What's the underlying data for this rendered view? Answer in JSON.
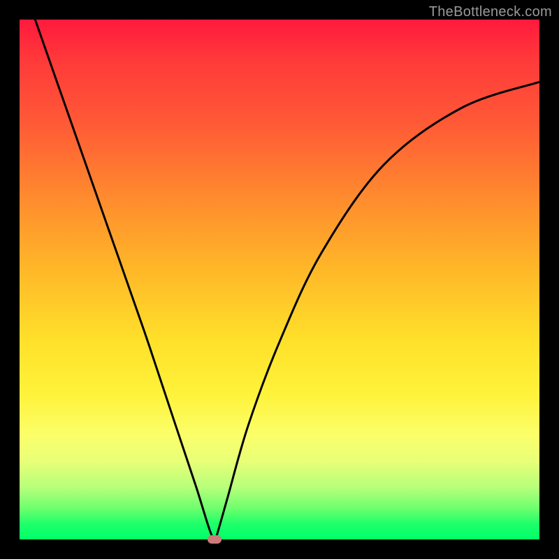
{
  "watermark": "TheBottleneck.com",
  "chart_data": {
    "type": "line",
    "title": "",
    "xlabel": "",
    "ylabel": "",
    "xlim": [
      0,
      1
    ],
    "ylim": [
      0,
      1
    ],
    "grid": false,
    "legend": false,
    "background_gradient": {
      "top": "#ff1a3c",
      "mid": "#ffe12a",
      "bottom": "#00ff69"
    },
    "series": [
      {
        "name": "bottleneck-curve",
        "color": "#000000",
        "x": [
          0.03,
          0.1,
          0.17,
          0.24,
          0.3,
          0.34,
          0.365,
          0.375,
          0.38,
          0.4,
          0.44,
          0.5,
          0.58,
          0.7,
          0.85,
          1.0
        ],
        "values": [
          1.0,
          0.8,
          0.6,
          0.4,
          0.22,
          0.1,
          0.02,
          0.0,
          0.01,
          0.08,
          0.22,
          0.38,
          0.55,
          0.72,
          0.83,
          0.88
        ]
      }
    ],
    "marker": {
      "name": "min-point",
      "x": 0.375,
      "y": 0.0,
      "color": "#cc7a7a"
    }
  }
}
